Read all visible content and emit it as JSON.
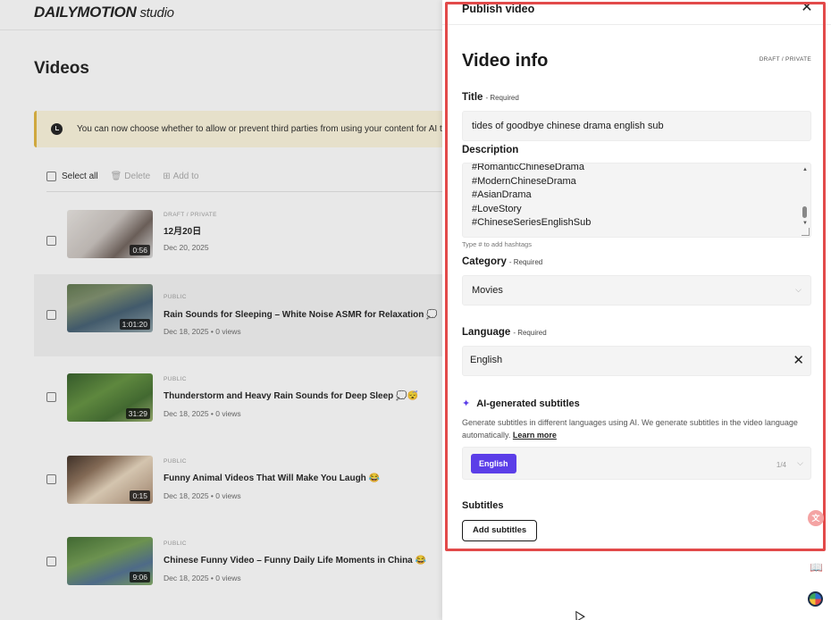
{
  "app": {
    "logo_main": "DAILYMOTION",
    "logo_sub": "studio"
  },
  "page": {
    "title": "Videos"
  },
  "notice": {
    "text": "You can now choose whether to allow or prevent third parties from using your content for AI t"
  },
  "toolbar": {
    "select_all": "Select all",
    "delete": "Delete",
    "add_to": "Add to"
  },
  "videos": [
    {
      "status": "DRAFT / PRIVATE",
      "title": "12月20日",
      "meta": "Dec 20, 2025",
      "duration": "0:56"
    },
    {
      "status": "PUBLIC",
      "title": "Rain Sounds for Sleeping – White Noise ASMR for Relaxation 💭",
      "meta": "Dec 18, 2025 • 0 views",
      "duration": "1:01:20"
    },
    {
      "status": "PUBLIC",
      "title": "Thunderstorm and Heavy Rain Sounds for Deep Sleep 💭😴",
      "meta": "Dec 18, 2025 • 0 views",
      "duration": "31:29"
    },
    {
      "status": "PUBLIC",
      "title": "Funny Animal Videos That Will Make You Laugh 😂",
      "meta": "Dec 18, 2025 • 0 views",
      "duration": "0:15"
    },
    {
      "status": "PUBLIC",
      "title": "Chinese Funny Video – Funny Daily Life Moments in China 😂",
      "meta": "Dec 18, 2025 • 0 views",
      "duration": "9:06"
    }
  ],
  "panel": {
    "header_title": "Publish video",
    "heading": "Video info",
    "status": "DRAFT / PRIVATE",
    "title_label": "Title",
    "required": "- Required",
    "title_value": "tides of goodbye chinese drama english sub",
    "description_label": "Description",
    "description_lines": [
      "#RomanticChineseDrama",
      "#ModernChineseDrama",
      "#AsianDrama",
      "#LoveStory",
      "#ChineseSeriesEnglishSub"
    ],
    "description_hint": "Type # to add hashtags",
    "category_label": "Category",
    "category_value": "Movies",
    "language_label": "Language",
    "language_value": "English",
    "ai_title": "AI-generated subtitles",
    "ai_desc": "Generate subtitles in different languages using AI. We generate subtitles in the video language automatically.",
    "ai_learn_more": "Learn more",
    "ai_chip": "English",
    "ai_count": "1/4",
    "subtitles_title": "Subtitles",
    "add_subtitles": "Add subtitles"
  },
  "colors": {
    "accent": "#5b3ee8",
    "highlight": "#e24a4a",
    "notice_bg": "#fdf6dc",
    "notice_border": "#e2b53a"
  },
  "icons": {
    "notice": "clock-icon",
    "close": "close-icon",
    "clear": "clear-icon",
    "sparkle": "sparkle-icon",
    "chevron": "chevron-down-icon"
  }
}
